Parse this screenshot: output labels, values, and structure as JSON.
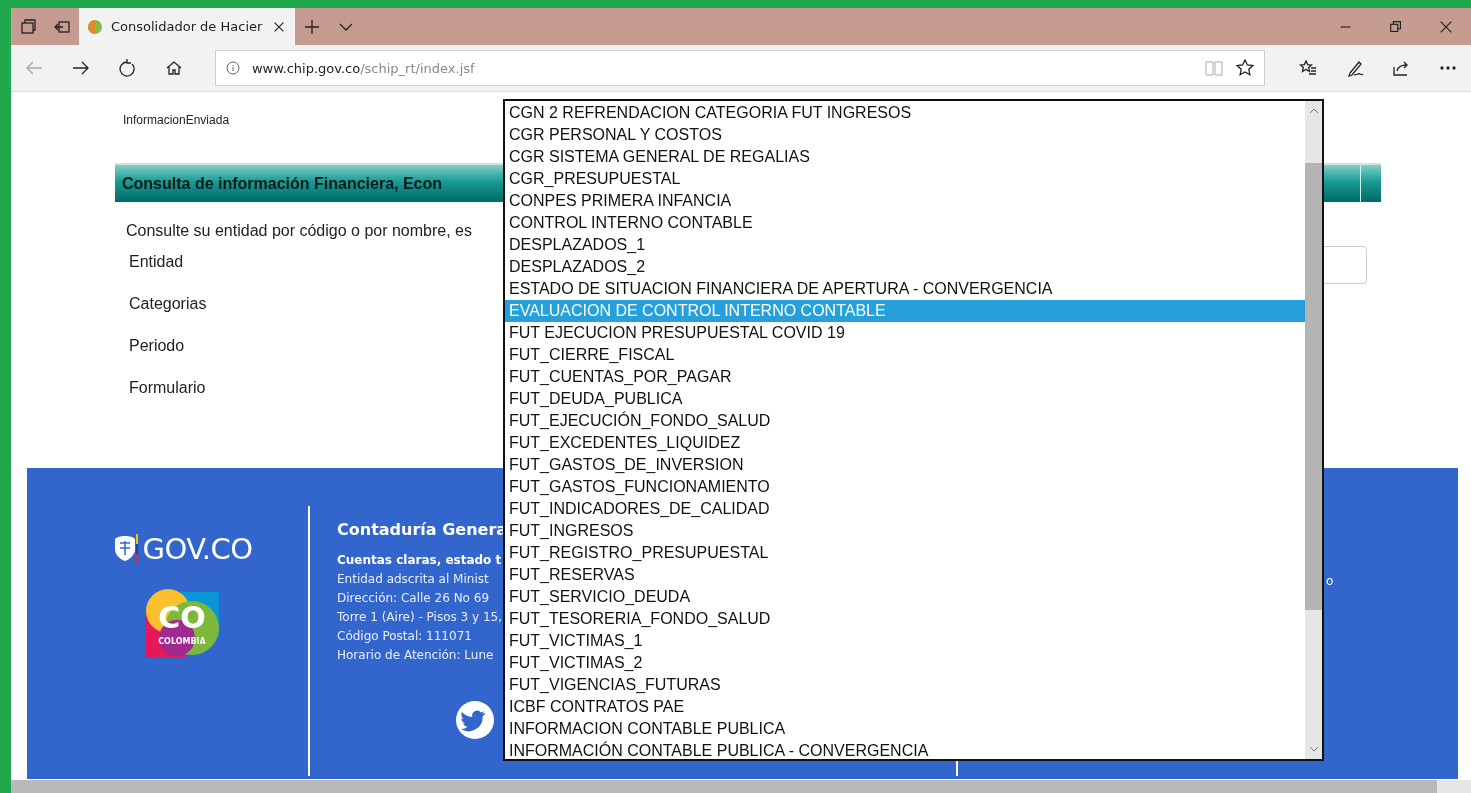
{
  "browser": {
    "tab": {
      "title": "Consolidador de Hacier"
    },
    "back_disabled": true,
    "url": {
      "host": "www.chip.gov.co",
      "path": "/schip_rt/index.jsf"
    }
  },
  "page": {
    "link": "InformacionEnviada",
    "header": "Consulta de información Financiera, Econ",
    "instructions": "Consulte su entidad por código o por nombre, es",
    "form_labels": [
      "Entidad",
      "Categorias",
      "Periodo",
      "Formulario"
    ]
  },
  "footer": {
    "logo": "GOV.CO",
    "badge": {
      "big": "CO",
      "small": "COLOMBIA"
    },
    "title": "Contaduría Genera",
    "tagline": "Cuentas claras, estado t",
    "lines": [
      "Entidad adscrita al Minist",
      "Dirección: Calle 26 No 69",
      "Torre 1 (Aire) - Pisos 3 y 15,",
      "Código Postal: 111071",
      "Horario de Atención: Lune"
    ],
    "fragment": "o"
  },
  "dropdown": {
    "options": [
      {
        "label": "CGN 2 REFRENDACION CATEGORIA FUT INGRESOS",
        "selected": false
      },
      {
        "label": "CGR PERSONAL Y COSTOS",
        "selected": false
      },
      {
        "label": "CGR SISTEMA GENERAL DE REGALIAS",
        "selected": false
      },
      {
        "label": "CGR_PRESUPUESTAL",
        "selected": false
      },
      {
        "label": "CONPES PRIMERA INFANCIA",
        "selected": false
      },
      {
        "label": "CONTROL INTERNO CONTABLE",
        "selected": false
      },
      {
        "label": "DESPLAZADOS_1",
        "selected": false
      },
      {
        "label": "DESPLAZADOS_2",
        "selected": false
      },
      {
        "label": "ESTADO DE SITUACION FINANCIERA DE APERTURA - CONVERGENCIA",
        "selected": false
      },
      {
        "label": "EVALUACION DE CONTROL INTERNO CONTABLE",
        "selected": true
      },
      {
        "label": "FUT EJECUCION PRESUPUESTAL COVID 19",
        "selected": false
      },
      {
        "label": "FUT_CIERRE_FISCAL",
        "selected": false
      },
      {
        "label": "FUT_CUENTAS_POR_PAGAR",
        "selected": false
      },
      {
        "label": "FUT_DEUDA_PUBLICA",
        "selected": false
      },
      {
        "label": "FUT_EJECUCIÓN_FONDO_SALUD",
        "selected": false
      },
      {
        "label": "FUT_EXCEDENTES_LIQUIDEZ",
        "selected": false
      },
      {
        "label": "FUT_GASTOS_DE_INVERSION",
        "selected": false
      },
      {
        "label": "FUT_GASTOS_FUNCIONAMIENTO",
        "selected": false
      },
      {
        "label": "FUT_INDICADORES_DE_CALIDAD",
        "selected": false
      },
      {
        "label": "FUT_INGRESOS",
        "selected": false
      },
      {
        "label": "FUT_REGISTRO_PRESUPUESTAL",
        "selected": false
      },
      {
        "label": "FUT_RESERVAS",
        "selected": false
      },
      {
        "label": "FUT_SERVICIO_DEUDA",
        "selected": false
      },
      {
        "label": "FUT_TESORERIA_FONDO_SALUD",
        "selected": false
      },
      {
        "label": "FUT_VICTIMAS_1",
        "selected": false
      },
      {
        "label": "FUT_VICTIMAS_2",
        "selected": false
      },
      {
        "label": "FUT_VIGENCIAS_FUTURAS",
        "selected": false
      },
      {
        "label": "ICBF CONTRATOS PAE",
        "selected": false
      },
      {
        "label": "INFORMACION CONTABLE PUBLICA",
        "selected": false
      },
      {
        "label": "INFORMACIÓN CONTABLE PUBLICA - CONVERGENCIA",
        "selected": false
      }
    ]
  }
}
